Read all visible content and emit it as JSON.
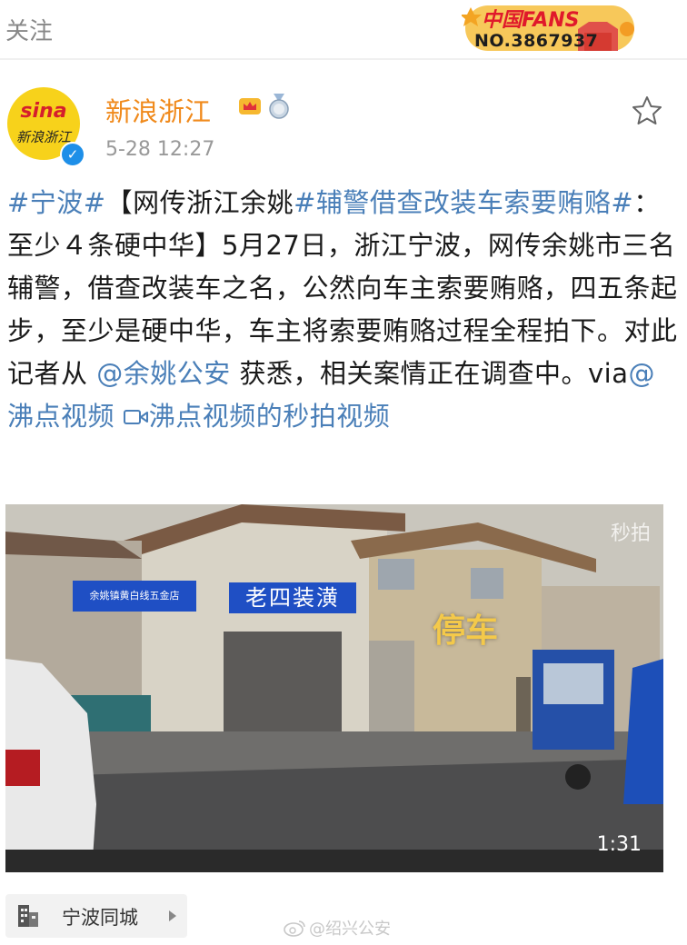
{
  "topbar": {
    "follow_label": "关注",
    "badge": {
      "brand": "中国FANS",
      "number": "NO.3867937"
    }
  },
  "post": {
    "author": "新浪浙江",
    "avatar_brand": "sina",
    "avatar_cn": "新浪浙江",
    "time": "5-28 12:27",
    "text": {
      "tag1": "#宁波#",
      "seg1": "【网传浙江余姚",
      "tag2": "#辅警借查改装车索要贿赂#",
      "seg2": "：至少４条硬中华】5月27日，浙江宁波，网传余姚市三名辅警，借查改装车之名，公然向车主索要贿赂，四五条起步，至少是硬中华，车主将索要贿赂过程全程拍下。对此记者从",
      "mention1": "@余姚公安",
      "seg3": " 获悉，相关案情正在调查中。via",
      "mention2": "@沸点视频",
      "video_link": "沸点视频的秒拍视频"
    }
  },
  "video": {
    "watermark": "秒拍",
    "overlay_text": "停车",
    "sign_text": "老四装潢",
    "sign2_text": "余姚镇黄白线五金店",
    "duration": "1:31"
  },
  "footer": {
    "location_label": "宁波同城",
    "credit": "@绍兴公安"
  },
  "colors": {
    "accent_orange": "#f08a1c",
    "link_blue": "#4a7fb8",
    "verified_blue": "#1e8fe8"
  }
}
